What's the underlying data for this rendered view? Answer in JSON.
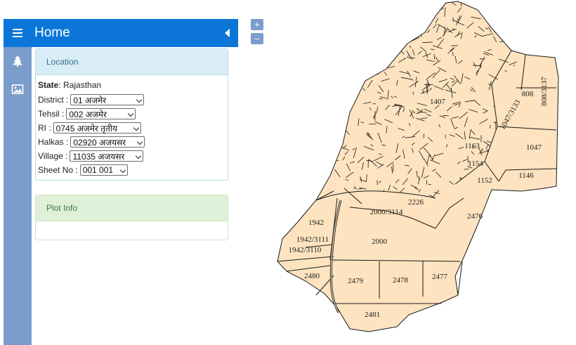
{
  "header": {
    "title": "Home"
  },
  "location": {
    "title": "Location",
    "state_label": "State",
    "state_value": "Rajasthan",
    "fields": [
      {
        "label": "District :",
        "value": "01 अजमेर"
      },
      {
        "label": "Tehsil :",
        "value": "002 अजमेर"
      },
      {
        "label": "RI :",
        "value": "0745 अजमेर तृतीय"
      },
      {
        "label": "Halkas :",
        "value": "02920 अजयसर"
      },
      {
        "label": "Village :",
        "value": "11035 अजयसर"
      },
      {
        "label": "Sheet No :",
        "value": "001 001"
      }
    ]
  },
  "plot_info": {
    "title": "Plot Info"
  },
  "zoom": {
    "in": "+",
    "out": "–"
  },
  "map": {
    "fill_color": "#fde3bf",
    "line_color": "#1a1a1a",
    "plot_labels": [
      "808",
      "808/3137",
      "1047",
      "1047/3133",
      "1146",
      "1152",
      "1154",
      "1163",
      "1407",
      "2226",
      "2000/3114",
      "2476",
      "1942",
      "1942/3111",
      "1942/3110",
      "2000",
      "2480",
      "2479",
      "2478",
      "2477",
      "2481"
    ]
  }
}
